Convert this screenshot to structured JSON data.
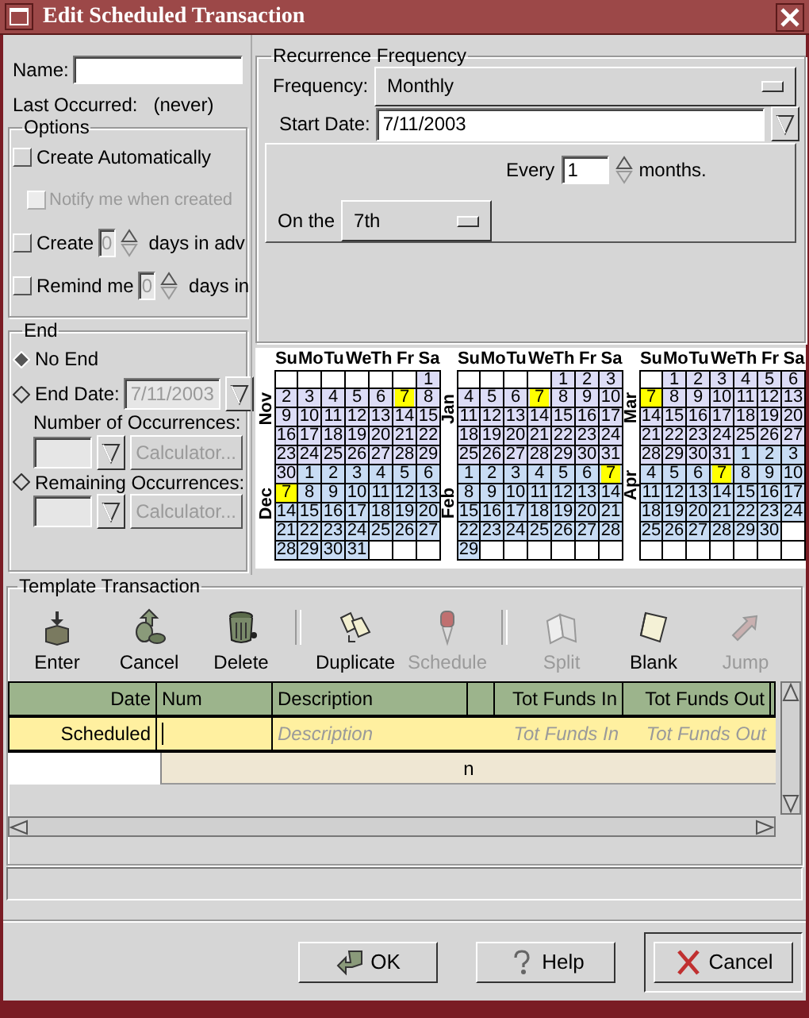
{
  "window": {
    "title": "Edit Scheduled Transaction"
  },
  "name_field": {
    "label": "Name:"
  },
  "last_occurred": {
    "label": "Last Occurred:",
    "value": "(never)"
  },
  "options": {
    "title": "Options",
    "items": [
      {
        "kind": "checkbox",
        "label": "Create Automatically",
        "checked": false,
        "children": [
          {
            "kind": "checkbox",
            "label": "Notify me when created",
            "checked": false,
            "disabled": true
          }
        ]
      },
      {
        "kind": "spin",
        "label": "Create",
        "checked": false,
        "value": "0",
        "suffix": "days in adv"
      },
      {
        "kind": "spin",
        "label": "Remind me",
        "checked": false,
        "value": "0",
        "suffix": "days in"
      }
    ]
  },
  "end": {
    "title": "End",
    "options": [
      {
        "kind": "radio",
        "label": "No End",
        "selected": true
      },
      {
        "kind": "radio_date",
        "label": "End Date:",
        "selected": false,
        "value": "7/11/2003"
      },
      {
        "kind": "count",
        "label": "Number of Occurrences:",
        "disabled": true,
        "button": "Calculator..."
      },
      {
        "kind": "radio_count",
        "label": "Remaining Occurrences:",
        "selected": false,
        "disabled": true,
        "button": "Calculator..."
      }
    ]
  },
  "recurrence": {
    "title": "Recurrence Frequency",
    "frequency": {
      "label": "Frequency:",
      "value": "Monthly"
    },
    "start_date": {
      "label": "Start Date:",
      "value": "7/11/2003"
    },
    "every": {
      "label": "Every",
      "value": "1",
      "suffix": "months."
    },
    "on_the": {
      "label": "On the",
      "value": "7th"
    }
  },
  "calendar": {
    "columns": [
      {
        "weekdays": [
          "Su",
          "Mo",
          "Tu",
          "We",
          "Th",
          "Fr",
          "Sa"
        ],
        "months": [
          {
            "label": "Nov",
            "color": "#dcdcf6",
            "days": [
              {
                "kind": "blank"
              },
              {
                "kind": "blank"
              },
              {
                "kind": "blank"
              },
              {
                "kind": "blank"
              },
              {
                "kind": "blank"
              },
              {
                "kind": "blank"
              },
              {
                "kind": "day",
                "day": "1",
                "marked": false
              },
              {
                "kind": "day",
                "day": "2",
                "marked": false
              },
              {
                "kind": "day",
                "day": "3",
                "marked": false
              },
              {
                "kind": "day",
                "day": "4",
                "marked": false
              },
              {
                "kind": "day",
                "day": "5",
                "marked": false
              },
              {
                "kind": "day",
                "day": "6",
                "marked": false
              },
              {
                "kind": "day",
                "day": "7",
                "marked": true
              },
              {
                "kind": "day",
                "day": "8",
                "marked": false
              },
              {
                "kind": "day",
                "day": "9",
                "marked": false
              },
              {
                "kind": "day",
                "day": "10",
                "marked": false
              },
              {
                "kind": "day",
                "day": "11",
                "marked": false
              },
              {
                "kind": "day",
                "day": "12",
                "marked": false
              },
              {
                "kind": "day",
                "day": "13",
                "marked": false
              },
              {
                "kind": "day",
                "day": "14",
                "marked": false
              },
              {
                "kind": "day",
                "day": "15",
                "marked": false
              },
              {
                "kind": "day",
                "day": "16",
                "marked": false
              },
              {
                "kind": "day",
                "day": "17",
                "marked": false
              },
              {
                "kind": "day",
                "day": "18",
                "marked": false
              },
              {
                "kind": "day",
                "day": "19",
                "marked": false
              },
              {
                "kind": "day",
                "day": "20",
                "marked": false
              },
              {
                "kind": "day",
                "day": "21",
                "marked": false
              },
              {
                "kind": "day",
                "day": "22",
                "marked": false
              },
              {
                "kind": "day",
                "day": "23",
                "marked": false
              },
              {
                "kind": "day",
                "day": "24",
                "marked": false
              },
              {
                "kind": "day",
                "day": "25",
                "marked": false
              },
              {
                "kind": "day",
                "day": "26",
                "marked": false
              },
              {
                "kind": "day",
                "day": "27",
                "marked": false
              },
              {
                "kind": "day",
                "day": "28",
                "marked": false
              },
              {
                "kind": "day",
                "day": "29",
                "marked": false
              },
              {
                "kind": "day",
                "day": "30",
                "marked": false
              }
            ]
          },
          {
            "label": "Dec",
            "color": "#c8dcf4",
            "days": [
              {
                "kind": "day",
                "day": "1",
                "marked": false
              },
              {
                "kind": "day",
                "day": "2",
                "marked": false
              },
              {
                "kind": "day",
                "day": "3",
                "marked": false
              },
              {
                "kind": "day",
                "day": "4",
                "marked": false
              },
              {
                "kind": "day",
                "day": "5",
                "marked": false
              },
              {
                "kind": "day",
                "day": "6",
                "marked": false
              },
              {
                "kind": "day",
                "day": "7",
                "marked": true
              },
              {
                "kind": "day",
                "day": "8",
                "marked": false
              },
              {
                "kind": "day",
                "day": "9",
                "marked": false
              },
              {
                "kind": "day",
                "day": "10",
                "marked": false
              },
              {
                "kind": "day",
                "day": "11",
                "marked": false
              },
              {
                "kind": "day",
                "day": "12",
                "marked": false
              },
              {
                "kind": "day",
                "day": "13",
                "marked": false
              },
              {
                "kind": "day",
                "day": "14",
                "marked": false
              },
              {
                "kind": "day",
                "day": "15",
                "marked": false
              },
              {
                "kind": "day",
                "day": "16",
                "marked": false
              },
              {
                "kind": "day",
                "day": "17",
                "marked": false
              },
              {
                "kind": "day",
                "day": "18",
                "marked": false
              },
              {
                "kind": "day",
                "day": "19",
                "marked": false
              },
              {
                "kind": "day",
                "day": "20",
                "marked": false
              },
              {
                "kind": "day",
                "day": "21",
                "marked": false
              },
              {
                "kind": "day",
                "day": "22",
                "marked": false
              },
              {
                "kind": "day",
                "day": "23",
                "marked": false
              },
              {
                "kind": "day",
                "day": "24",
                "marked": false
              },
              {
                "kind": "day",
                "day": "25",
                "marked": false
              },
              {
                "kind": "day",
                "day": "26",
                "marked": false
              },
              {
                "kind": "day",
                "day": "27",
                "marked": false
              },
              {
                "kind": "day",
                "day": "28",
                "marked": false
              },
              {
                "kind": "day",
                "day": "29",
                "marked": false
              },
              {
                "kind": "day",
                "day": "30",
                "marked": false
              },
              {
                "kind": "day",
                "day": "31",
                "marked": false
              },
              {
                "kind": "blank"
              },
              {
                "kind": "blank"
              },
              {
                "kind": "blank"
              }
            ]
          }
        ]
      },
      {
        "weekdays": [
          "Su",
          "Mo",
          "Tu",
          "We",
          "Th",
          "Fr",
          "Sa"
        ],
        "months": [
          {
            "label": "Jan",
            "color": "#dcdcf6",
            "days": [
              {
                "kind": "blank"
              },
              {
                "kind": "blank"
              },
              {
                "kind": "blank"
              },
              {
                "kind": "blank"
              },
              {
                "kind": "day",
                "day": "1",
                "marked": false
              },
              {
                "kind": "day",
                "day": "2",
                "marked": false
              },
              {
                "kind": "day",
                "day": "3",
                "marked": false
              },
              {
                "kind": "day",
                "day": "4",
                "marked": false
              },
              {
                "kind": "day",
                "day": "5",
                "marked": false
              },
              {
                "kind": "day",
                "day": "6",
                "marked": false
              },
              {
                "kind": "day",
                "day": "7",
                "marked": true
              },
              {
                "kind": "day",
                "day": "8",
                "marked": false
              },
              {
                "kind": "day",
                "day": "9",
                "marked": false
              },
              {
                "kind": "day",
                "day": "10",
                "marked": false
              },
              {
                "kind": "day",
                "day": "11",
                "marked": false
              },
              {
                "kind": "day",
                "day": "12",
                "marked": false
              },
              {
                "kind": "day",
                "day": "13",
                "marked": false
              },
              {
                "kind": "day",
                "day": "14",
                "marked": false
              },
              {
                "kind": "day",
                "day": "15",
                "marked": false
              },
              {
                "kind": "day",
                "day": "16",
                "marked": false
              },
              {
                "kind": "day",
                "day": "17",
                "marked": false
              },
              {
                "kind": "day",
                "day": "18",
                "marked": false
              },
              {
                "kind": "day",
                "day": "19",
                "marked": false
              },
              {
                "kind": "day",
                "day": "20",
                "marked": false
              },
              {
                "kind": "day",
                "day": "21",
                "marked": false
              },
              {
                "kind": "day",
                "day": "22",
                "marked": false
              },
              {
                "kind": "day",
                "day": "23",
                "marked": false
              },
              {
                "kind": "day",
                "day": "24",
                "marked": false
              },
              {
                "kind": "day",
                "day": "25",
                "marked": false
              },
              {
                "kind": "day",
                "day": "26",
                "marked": false
              },
              {
                "kind": "day",
                "day": "27",
                "marked": false
              },
              {
                "kind": "day",
                "day": "28",
                "marked": false
              },
              {
                "kind": "day",
                "day": "29",
                "marked": false
              },
              {
                "kind": "day",
                "day": "30",
                "marked": false
              },
              {
                "kind": "day",
                "day": "31",
                "marked": false
              }
            ]
          },
          {
            "label": "Feb",
            "color": "#c8dcf4",
            "days": [
              {
                "kind": "day",
                "day": "1",
                "marked": false
              },
              {
                "kind": "day",
                "day": "2",
                "marked": false
              },
              {
                "kind": "day",
                "day": "3",
                "marked": false
              },
              {
                "kind": "day",
                "day": "4",
                "marked": false
              },
              {
                "kind": "day",
                "day": "5",
                "marked": false
              },
              {
                "kind": "day",
                "day": "6",
                "marked": false
              },
              {
                "kind": "day",
                "day": "7",
                "marked": true
              },
              {
                "kind": "day",
                "day": "8",
                "marked": false
              },
              {
                "kind": "day",
                "day": "9",
                "marked": false
              },
              {
                "kind": "day",
                "day": "10",
                "marked": false
              },
              {
                "kind": "day",
                "day": "11",
                "marked": false
              },
              {
                "kind": "day",
                "day": "12",
                "marked": false
              },
              {
                "kind": "day",
                "day": "13",
                "marked": false
              },
              {
                "kind": "day",
                "day": "14",
                "marked": false
              },
              {
                "kind": "day",
                "day": "15",
                "marked": false
              },
              {
                "kind": "day",
                "day": "16",
                "marked": false
              },
              {
                "kind": "day",
                "day": "17",
                "marked": false
              },
              {
                "kind": "day",
                "day": "18",
                "marked": false
              },
              {
                "kind": "day",
                "day": "19",
                "marked": false
              },
              {
                "kind": "day",
                "day": "20",
                "marked": false
              },
              {
                "kind": "day",
                "day": "21",
                "marked": false
              },
              {
                "kind": "day",
                "day": "22",
                "marked": false
              },
              {
                "kind": "day",
                "day": "23",
                "marked": false
              },
              {
                "kind": "day",
                "day": "24",
                "marked": false
              },
              {
                "kind": "day",
                "day": "25",
                "marked": false
              },
              {
                "kind": "day",
                "day": "26",
                "marked": false
              },
              {
                "kind": "day",
                "day": "27",
                "marked": false
              },
              {
                "kind": "day",
                "day": "28",
                "marked": false
              },
              {
                "kind": "day",
                "day": "29",
                "marked": false
              },
              {
                "kind": "blank"
              },
              {
                "kind": "blank"
              },
              {
                "kind": "blank"
              },
              {
                "kind": "blank"
              },
              {
                "kind": "blank"
              },
              {
                "kind": "blank"
              }
            ]
          }
        ]
      },
      {
        "weekdays": [
          "Su",
          "Mo",
          "Tu",
          "We",
          "Th",
          "Fr",
          "Sa"
        ],
        "months": [
          {
            "label": "Mar",
            "color": "#dcdcf6",
            "days": [
              {
                "kind": "blank"
              },
              {
                "kind": "day",
                "day": "1",
                "marked": false
              },
              {
                "kind": "day",
                "day": "2",
                "marked": false
              },
              {
                "kind": "day",
                "day": "3",
                "marked": false
              },
              {
                "kind": "day",
                "day": "4",
                "marked": false
              },
              {
                "kind": "day",
                "day": "5",
                "marked": false
              },
              {
                "kind": "day",
                "day": "6",
                "marked": false
              },
              {
                "kind": "day",
                "day": "7",
                "marked": true
              },
              {
                "kind": "day",
                "day": "8",
                "marked": false
              },
              {
                "kind": "day",
                "day": "9",
                "marked": false
              },
              {
                "kind": "day",
                "day": "10",
                "marked": false
              },
              {
                "kind": "day",
                "day": "11",
                "marked": false
              },
              {
                "kind": "day",
                "day": "12",
                "marked": false
              },
              {
                "kind": "day",
                "day": "13",
                "marked": false
              },
              {
                "kind": "day",
                "day": "14",
                "marked": false
              },
              {
                "kind": "day",
                "day": "15",
                "marked": false
              },
              {
                "kind": "day",
                "day": "16",
                "marked": false
              },
              {
                "kind": "day",
                "day": "17",
                "marked": false
              },
              {
                "kind": "day",
                "day": "18",
                "marked": false
              },
              {
                "kind": "day",
                "day": "19",
                "marked": false
              },
              {
                "kind": "day",
                "day": "20",
                "marked": false
              },
              {
                "kind": "day",
                "day": "21",
                "marked": false
              },
              {
                "kind": "day",
                "day": "22",
                "marked": false
              },
              {
                "kind": "day",
                "day": "23",
                "marked": false
              },
              {
                "kind": "day",
                "day": "24",
                "marked": false
              },
              {
                "kind": "day",
                "day": "25",
                "marked": false
              },
              {
                "kind": "day",
                "day": "26",
                "marked": false
              },
              {
                "kind": "day",
                "day": "27",
                "marked": false
              },
              {
                "kind": "day",
                "day": "28",
                "marked": false
              },
              {
                "kind": "day",
                "day": "29",
                "marked": false
              },
              {
                "kind": "day",
                "day": "30",
                "marked": false
              },
              {
                "kind": "day",
                "day": "31",
                "marked": false
              }
            ]
          },
          {
            "label": "Apr",
            "color": "#c8dcf4",
            "days": [
              {
                "kind": "day",
                "day": "1",
                "marked": false
              },
              {
                "kind": "day",
                "day": "2",
                "marked": false
              },
              {
                "kind": "day",
                "day": "3",
                "marked": false
              },
              {
                "kind": "day",
                "day": "4",
                "marked": false
              },
              {
                "kind": "day",
                "day": "5",
                "marked": false
              },
              {
                "kind": "day",
                "day": "6",
                "marked": false
              },
              {
                "kind": "day",
                "day": "7",
                "marked": true
              },
              {
                "kind": "day",
                "day": "8",
                "marked": false
              },
              {
                "kind": "day",
                "day": "9",
                "marked": false
              },
              {
                "kind": "day",
                "day": "10",
                "marked": false
              },
              {
                "kind": "day",
                "day": "11",
                "marked": false
              },
              {
                "kind": "day",
                "day": "12",
                "marked": false
              },
              {
                "kind": "day",
                "day": "13",
                "marked": false
              },
              {
                "kind": "day",
                "day": "14",
                "marked": false
              },
              {
                "kind": "day",
                "day": "15",
                "marked": false
              },
              {
                "kind": "day",
                "day": "16",
                "marked": false
              },
              {
                "kind": "day",
                "day": "17",
                "marked": false
              },
              {
                "kind": "day",
                "day": "18",
                "marked": false
              },
              {
                "kind": "day",
                "day": "19",
                "marked": false
              },
              {
                "kind": "day",
                "day": "20",
                "marked": false
              },
              {
                "kind": "day",
                "day": "21",
                "marked": false
              },
              {
                "kind": "day",
                "day": "22",
                "marked": false
              },
              {
                "kind": "day",
                "day": "23",
                "marked": false
              },
              {
                "kind": "day",
                "day": "24",
                "marked": false
              },
              {
                "kind": "day",
                "day": "25",
                "marked": false
              },
              {
                "kind": "day",
                "day": "26",
                "marked": false
              },
              {
                "kind": "day",
                "day": "27",
                "marked": false
              },
              {
                "kind": "day",
                "day": "28",
                "marked": false
              },
              {
                "kind": "day",
                "day": "29",
                "marked": false
              },
              {
                "kind": "day",
                "day": "30",
                "marked": false
              },
              {
                "kind": "blank"
              },
              {
                "kind": "blank"
              },
              {
                "kind": "blank"
              },
              {
                "kind": "blank"
              },
              {
                "kind": "blank"
              },
              {
                "kind": "blank"
              },
              {
                "kind": "blank"
              },
              {
                "kind": "blank"
              }
            ]
          }
        ]
      }
    ]
  },
  "template": {
    "title": "Template Transaction",
    "toolbar": [
      {
        "kind": "enter",
        "label": "Enter",
        "disabled": false
      },
      {
        "kind": "cancel",
        "label": "Cancel",
        "disabled": false
      },
      {
        "kind": "delete",
        "label": "Delete",
        "disabled": false
      },
      {
        "kind": "separator"
      },
      {
        "kind": "duplicate",
        "label": "Duplicate",
        "disabled": false
      },
      {
        "kind": "schedule",
        "label": "Schedule",
        "disabled": true
      },
      {
        "kind": "separator"
      },
      {
        "kind": "split",
        "label": "Split",
        "disabled": true
      },
      {
        "kind": "blank",
        "label": "Blank",
        "disabled": false
      },
      {
        "kind": "jump",
        "label": "Jump",
        "disabled": true
      }
    ],
    "register": {
      "columns": [
        {
          "kind": "date",
          "label": "Date"
        },
        {
          "kind": "num",
          "label": "Num"
        },
        {
          "kind": "description",
          "label": "Description"
        },
        {
          "kind": "spacer"
        },
        {
          "kind": "amount_in",
          "label": "Tot Funds In"
        },
        {
          "kind": "amount_out",
          "label": "Tot Funds Out"
        }
      ],
      "entry": {
        "date": "Scheduled",
        "editing": true,
        "description_placeholder": "Description",
        "funds_in_placeholder": "Tot Funds In",
        "funds_out_placeholder": "Tot Funds Out"
      },
      "notes_row": {
        "text": "n"
      }
    }
  },
  "buttons": [
    {
      "kind": "ok",
      "label": "OK",
      "default": false
    },
    {
      "kind": "help",
      "label": "Help",
      "default": false
    },
    {
      "kind": "cancel",
      "label": "Cancel",
      "default": true
    }
  ]
}
